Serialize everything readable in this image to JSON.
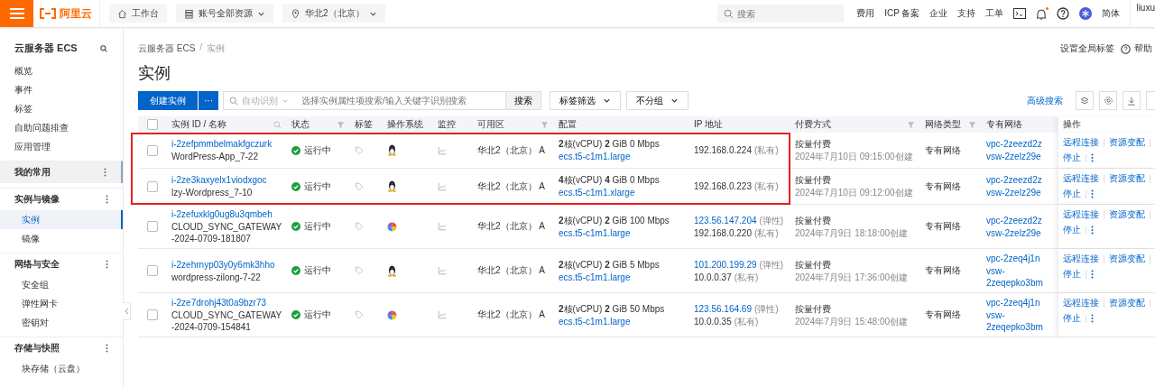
{
  "topbar": {
    "logo": "阿里云",
    "nav": [
      {
        "label": "工作台",
        "kind": "home",
        "dropdown": false
      },
      {
        "label": "账号全部资源",
        "kind": "stack",
        "dropdown": true
      },
      {
        "label": "华北2（北京）",
        "kind": "pin",
        "dropdown": true
      }
    ],
    "search": {
      "placeholder": "搜索"
    },
    "links": [
      "费用",
      "ICP 备案",
      "企业",
      "支持",
      "工单"
    ],
    "notification_dot": true,
    "language": "简体",
    "user": "liuxu"
  },
  "sidebar": {
    "title": "云服务器 ECS",
    "items": [
      {
        "label": "概览",
        "kind": "link",
        "selected": false
      },
      {
        "label": "事件",
        "kind": "link",
        "selected": false
      },
      {
        "label": "标签",
        "kind": "link",
        "selected": false
      },
      {
        "label": "自助问题排查",
        "kind": "link",
        "selected": false
      },
      {
        "label": "应用管理",
        "kind": "link",
        "selected": false
      },
      {
        "label": "我的常用",
        "kind": "pinned",
        "selected": false
      },
      {
        "label": "实例与镜像",
        "kind": "group",
        "selected": false,
        "children": [
          {
            "label": "实例",
            "selected": true
          },
          {
            "label": "镜像",
            "selected": false
          }
        ]
      },
      {
        "label": "网络与安全",
        "kind": "group",
        "selected": false,
        "children": [
          {
            "label": "安全组",
            "selected": false
          },
          {
            "label": "弹性网卡",
            "selected": false
          },
          {
            "label": "密钥对",
            "selected": false
          }
        ]
      },
      {
        "label": "存储与快照",
        "kind": "group",
        "selected": false,
        "children": [
          {
            "label": "块存储（云盘）",
            "selected": false
          }
        ]
      }
    ]
  },
  "breadcrumb": {
    "items": [
      "云服务器 ECS",
      "实例"
    ],
    "separator": "/"
  },
  "header_actions": {
    "global_tags": "设置全局标签",
    "help": "帮助"
  },
  "title": "实例",
  "toolbar": {
    "create": "创建实例",
    "more": "···",
    "search_scope": "自动识别",
    "search_placeholder": "选择实例属性项搜索/输入关键字识别搜索",
    "search_button": "搜索",
    "filters": [
      "标签筛选",
      "不分组"
    ],
    "advanced": "高级搜索"
  },
  "table": {
    "select_all": false,
    "columns": [
      {
        "label": "实例 ID / 名称",
        "kind": "search"
      },
      {
        "label": "状态",
        "kind": "filter"
      },
      {
        "label": "标签",
        "kind": "plain"
      },
      {
        "label": "操作系统",
        "kind": "plain"
      },
      {
        "label": "监控",
        "kind": "plain"
      },
      {
        "label": "可用区",
        "kind": "filter"
      },
      {
        "label": "配置",
        "kind": "plain"
      },
      {
        "label": "IP 地址",
        "kind": "plain"
      },
      {
        "label": "付费方式",
        "kind": "filter"
      },
      {
        "label": "网络类型",
        "kind": "filter"
      },
      {
        "label": "专有网络",
        "kind": "plain"
      },
      {
        "label": "操作",
        "kind": "plain"
      }
    ],
    "rows": [
      {
        "checked": false,
        "highlighted": true,
        "id": "i-2zefpmmbelmakfgczurk",
        "name": "WordPress-App_7-22",
        "status": "运行中",
        "os": {
          "kind": "linux"
        },
        "zone": "华北2（北京） A",
        "config": "**2**核(vCPU)  **2** GiB 0 Mbps",
        "type": "ecs.t5-c1m1.large",
        "ips": [
          {
            "address": "192.168.0.224",
            "note": "(私有)",
            "kind": "private"
          }
        ],
        "billing": "按量付费",
        "created": "2024年7月10日 09:15:00创建",
        "network": "专有网络",
        "vpc": "vpc-2zeezd2z",
        "vsw": "vsw-2zelz29e",
        "actions": [
          "远程连接",
          "资源变配",
          "停止"
        ]
      },
      {
        "checked": false,
        "highlighted": true,
        "id": "i-2ze3kaxyelx1viodxgoc",
        "name": "lzy-Wordpress_7-10",
        "status": "运行中",
        "os": {
          "kind": "linux"
        },
        "zone": "华北2（北京） A",
        "config": "**4**核(vCPU)  **4** GiB 0 Mbps",
        "type": "ecs.t5-c1m1.xlarge",
        "ips": [
          {
            "address": "192.168.0.223",
            "note": "(私有)",
            "kind": "private"
          }
        ],
        "billing": "按量付费",
        "created": "2024年7月10日 09:12:00创建",
        "network": "专有网络",
        "vpc": "vpc-2zeezd2z",
        "vsw": "vsw-2zelz29e",
        "actions": [
          "远程连接",
          "资源变配",
          "停止"
        ]
      },
      {
        "checked": false,
        "highlighted": false,
        "id": "i-2zefuxklg0ug8u3qmbeh",
        "name": "CLOUD_SYNC_GATEWAY-2024-0709-181807",
        "status": "运行中",
        "os": {
          "kind": "other"
        },
        "zone": "华北2（北京） A",
        "config": "**2**核(vCPU)  **2** GiB 100 Mbps",
        "type": "ecs.t5-c1m1.large",
        "ips": [
          {
            "address": "123.56.147.204",
            "note": "(弹性)",
            "kind": "public"
          },
          {
            "address": "192.168.0.220",
            "note": "(私有)",
            "kind": "private"
          }
        ],
        "billing": "按量付费",
        "created": "2024年7月9日 18:18:00创建",
        "network": "专有网络",
        "vpc": "vpc-2zeezd2z",
        "vsw": "vsw-2zelz29e",
        "actions": [
          "远程连接",
          "资源变配",
          "停止"
        ]
      },
      {
        "checked": false,
        "highlighted": false,
        "id": "i-2zehrnyp03y0y6mk3hho",
        "name": "wordpress-zilong-7-22",
        "status": "运行中",
        "os": {
          "kind": "linux"
        },
        "zone": "华北2（北京） A",
        "config": "**2**核(vCPU)  **2** GiB 5 Mbps",
        "type": "ecs.t5-c1m1.large",
        "ips": [
          {
            "address": "101.200.199.29",
            "note": "(弹性)",
            "kind": "public"
          },
          {
            "address": "10.0.0.37",
            "note": "(私有)",
            "kind": "private"
          }
        ],
        "billing": "按量付费",
        "created": "2024年7月9日 17:36:00创建",
        "network": "专有网络",
        "vpc": "vpc-2zeq4j1n",
        "vsw": "vsw-2zeqepko3bm",
        "actions": [
          "远程连接",
          "资源变配",
          "停止"
        ]
      },
      {
        "checked": false,
        "highlighted": false,
        "id": "i-2ze7drohj43t0a9bzr73",
        "name": "CLOUD_SYNC_GATEWAY-2024-0709-154841",
        "status": "运行中",
        "os": {
          "kind": "other"
        },
        "zone": "华北2（北京） A",
        "config": "**2**核(vCPU)  **2** GiB 50 Mbps",
        "type": "ecs.t5-c1m1.large",
        "ips": [
          {
            "address": "123.56.164.69",
            "note": "(弹性)",
            "kind": "public"
          },
          {
            "address": "10.0.0.35",
            "note": "(私有)",
            "kind": "private"
          }
        ],
        "billing": "按量付费",
        "created": "2024年7月9日 15:48:00创建",
        "network": "专有网络",
        "vpc": "vpc-2zeq4j1n",
        "vsw": "vsw-2zeqepko3bm",
        "actions": [
          "远程连接",
          "资源变配",
          "停止"
        ]
      }
    ]
  }
}
